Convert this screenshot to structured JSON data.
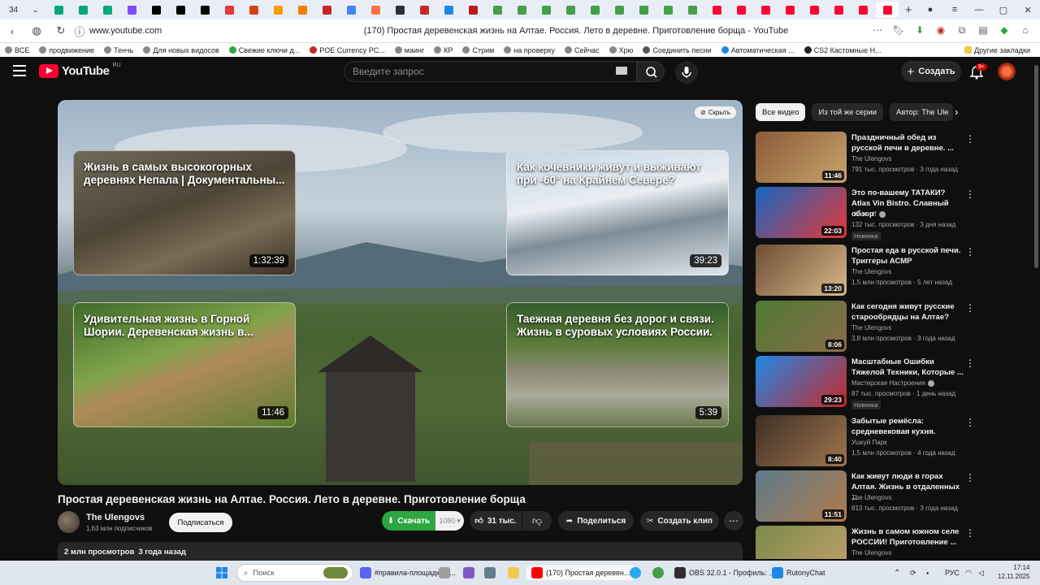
{
  "browser": {
    "tab_count": "34",
    "tabs": [
      {
        "icon": "ai-icon",
        "color": "#00a67e"
      },
      {
        "icon": "ai-icon",
        "color": "#00a67e"
      },
      {
        "icon": "ai-icon",
        "color": "#00a67e"
      },
      {
        "icon": "ai-icon",
        "color": "#7c4dff"
      },
      {
        "icon": "x-icon",
        "color": "#000000"
      },
      {
        "icon": "x-icon",
        "color": "#000000"
      },
      {
        "icon": "x-icon",
        "color": "#000000"
      },
      {
        "icon": "plus-icon",
        "color": "#e53935"
      },
      {
        "icon": "app-icon",
        "color": "#d84315"
      },
      {
        "icon": "app-icon",
        "color": "#ff9800"
      },
      {
        "icon": "app-icon",
        "color": "#f57c00"
      },
      {
        "icon": "app-icon",
        "color": "#c62828"
      },
      {
        "icon": "google-icon",
        "color": "#4285f4"
      },
      {
        "icon": "app-icon",
        "color": "#ff7043"
      },
      {
        "icon": "app-icon",
        "color": "#263238"
      },
      {
        "icon": "app-icon",
        "color": "#c62828"
      },
      {
        "icon": "app-icon",
        "color": "#1e88e5"
      },
      {
        "icon": "app-icon",
        "color": "#b71c1c"
      },
      {
        "icon": "hd-icon",
        "color": "#43a047"
      },
      {
        "icon": "hd-icon",
        "color": "#43a047"
      },
      {
        "icon": "hd-icon",
        "color": "#43a047"
      },
      {
        "icon": "hd-icon",
        "color": "#43a047"
      },
      {
        "icon": "hd-icon",
        "color": "#43a047"
      },
      {
        "icon": "hd-icon",
        "color": "#43a047"
      },
      {
        "icon": "hd-icon",
        "color": "#43a047"
      },
      {
        "icon": "hd-icon",
        "color": "#43a047"
      },
      {
        "icon": "hd-icon",
        "color": "#43a047"
      },
      {
        "icon": "youtube-icon",
        "color": "#ff0033"
      },
      {
        "icon": "youtube-icon",
        "color": "#ff0033"
      },
      {
        "icon": "youtube-icon",
        "color": "#ff0033"
      },
      {
        "icon": "youtube-icon",
        "color": "#ff0033"
      },
      {
        "icon": "youtube-icon",
        "color": "#ff0033"
      },
      {
        "icon": "youtube-icon",
        "color": "#ff0033"
      },
      {
        "icon": "youtube-icon",
        "color": "#ff0033"
      },
      {
        "icon": "youtube-icon",
        "color": "#ff0033",
        "active": true
      }
    ],
    "url": "www.youtube.com",
    "page_title": "(170) Простая деревенская жизнь на Алтае. Россия. Лето в деревне. Приготовление борща - YouTube",
    "bookmarks": [
      {
        "label": "ВСЕ",
        "color": "#888"
      },
      {
        "label": "продвижение",
        "color": "#888"
      },
      {
        "label": "Тенчь",
        "color": "#888"
      },
      {
        "label": "Для новых видосов",
        "color": "#888"
      },
      {
        "label": "Свежие ключи д...",
        "color": "#2ba640"
      },
      {
        "label": "POE Currency PC...",
        "color": "#c62828"
      },
      {
        "label": "маинг",
        "color": "#888"
      },
      {
        "label": "КР",
        "color": "#888"
      },
      {
        "label": "Стрим",
        "color": "#888"
      },
      {
        "label": "на проверку",
        "color": "#888"
      },
      {
        "label": "Сейчас",
        "color": "#888"
      },
      {
        "label": "Хрю",
        "color": "#888"
      },
      {
        "label": "Соединить песни",
        "color": "#555"
      },
      {
        "label": "Автоматическая ...",
        "color": "#1e88e5"
      },
      {
        "label": "CS2 Кастомные Н...",
        "color": "#222"
      }
    ],
    "bookmarks_other": "Другие закладки"
  },
  "youtube": {
    "logo_text": "YouTube",
    "country_code": "RU",
    "search_placeholder": "Введите запрос",
    "create_label": "Создать",
    "notif_count": "9+",
    "brand_color": "#ff0033"
  },
  "player": {
    "hide_label": "Скрыть",
    "end_cards": [
      {
        "title": "Жизнь в самых высокогорных деревнях Непала | Документальны...",
        "duration": "1:32:39"
      },
      {
        "title": "Как кочевники живут и выживают при -60° на Крайнем Севере?",
        "duration": "39:23"
      },
      {
        "title": "Удивительная жизнь в Горной Шории. Деревенская жизнь в...",
        "duration": "11:46"
      },
      {
        "title": "Таежная деревня без дорог и связи. Жизнь в суровых условиях России.",
        "duration": "5:39"
      }
    ]
  },
  "video": {
    "title": "Простая деревенская жизнь на Алтае. Россия. Лето в деревне. Приготовление борща",
    "channel": "The Ulengovs",
    "subscribers": "1,63 млн подписчиков",
    "subscribe_label": "Подписаться",
    "download_label": "Скачать",
    "quality": "1080",
    "likes": "31 тыс.",
    "share_label": "Поделиться",
    "clip_label": "Создать клип",
    "views": "2 млн просмотров",
    "age": "3 года назад"
  },
  "sidebar": {
    "chips": [
      {
        "label": "Все видео",
        "selected": true
      },
      {
        "label": "Из той же серии",
        "selected": false
      },
      {
        "label": "Автор: The Ule",
        "selected": false
      }
    ],
    "items": [
      {
        "title": "Праздничный обед из русской печи в деревне. ...",
        "channel": "The Ulengovs",
        "meta": "791 тыс. просмотров · 3 года назад",
        "duration": "11:46",
        "verified": false,
        "new": ""
      },
      {
        "title": "Это по-вашему ТАТАКИ? Atlas Vin Bistro. Славный обзор",
        "channel": "oblomoff",
        "meta": "132 тыс. просмотров · 3 дня назад",
        "duration": "22:03",
        "verified": true,
        "new": "Новинка"
      },
      {
        "title": "Простая еда в русской печи. Триггеры АСМР",
        "channel": "The Ulengovs",
        "meta": "1,5 млн просмотров · 5 лет назад",
        "duration": "13:20",
        "verified": false,
        "new": ""
      },
      {
        "title": "Как сегодня живут русские старообрядцы на Алтае?",
        "channel": "The Ulengovs",
        "meta": "3,8 млн просмотров · 3 года назад",
        "duration": "8:06",
        "verified": false,
        "new": ""
      },
      {
        "title": "Масштабные Ошибки Тяжелой Техники, Которые ...",
        "channel": "Мастерская Настроения",
        "meta": "87 тыс. просмотров · 1 день назад",
        "duration": "29:23",
        "verified": true,
        "new": "Новинка"
      },
      {
        "title": "Забытые ремёсла: средневековая кухня.",
        "channel": "Ушкуй Парк",
        "meta": "1,5 млн просмотров · 4 года назад",
        "duration": "8:40",
        "verified": false,
        "new": ""
      },
      {
        "title": "Как живут люди в горах Алтая. Жизнь в отдаленных ...",
        "channel": "The Ulengovs",
        "meta": "813 тыс. просмотров · 3 года назад",
        "duration": "11:51",
        "verified": false,
        "new": ""
      },
      {
        "title": "Жизнь в самом южном селе РОССИИ! Приготовление ...",
        "channel": "The Ulengovs",
        "meta": "",
        "duration": "",
        "verified": false,
        "new": ""
      }
    ]
  },
  "taskbar": {
    "search_placeholder": "Поиск",
    "items": [
      {
        "label": "#правила-площадки | ...",
        "icon": "discord-icon",
        "color": "#5865f2"
      },
      {
        "label": "(170) Простая деревен...",
        "icon": "yandex-browser-icon",
        "color": "#ff0000"
      },
      {
        "label": "OBS 32.0.1 - Профиль: ...",
        "icon": "obs-icon",
        "color": "#302e31"
      },
      {
        "label": "RutonyChat",
        "icon": "chat-icon",
        "color": "#1e88e5"
      }
    ],
    "lang": "РУС",
    "time": "17:14",
    "date": "12.11.2025"
  }
}
